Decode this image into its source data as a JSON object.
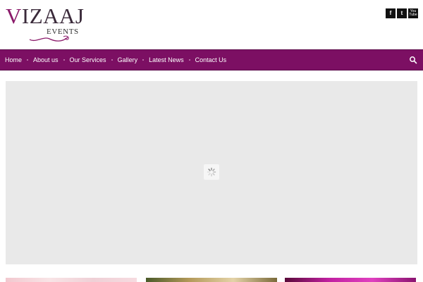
{
  "header": {
    "logo": {
      "first_letter": "V",
      "main_rest": "IZAAJ",
      "sub": "EVENTS"
    },
    "social": [
      {
        "name": "facebook",
        "glyph": "f",
        "icon": "facebook-icon"
      },
      {
        "name": "twitter",
        "glyph": "t",
        "icon": "twitter-icon"
      },
      {
        "name": "youtube",
        "glyph": "You Tube",
        "icon": "youtube-icon"
      }
    ]
  },
  "nav": {
    "items": [
      {
        "label": "Home"
      },
      {
        "label": "About us"
      },
      {
        "label": "Our Services"
      },
      {
        "label": "Gallery"
      },
      {
        "label": "Latest News"
      },
      {
        "label": "Contact Us"
      }
    ],
    "search_icon": "search-icon"
  },
  "slider": {
    "state": "loading",
    "loader_icon": "spinner-icon"
  },
  "colors": {
    "brand": "#7c0f63",
    "logo_accent": "#8a1a6a",
    "slider_bg": "#e9e9e9"
  }
}
